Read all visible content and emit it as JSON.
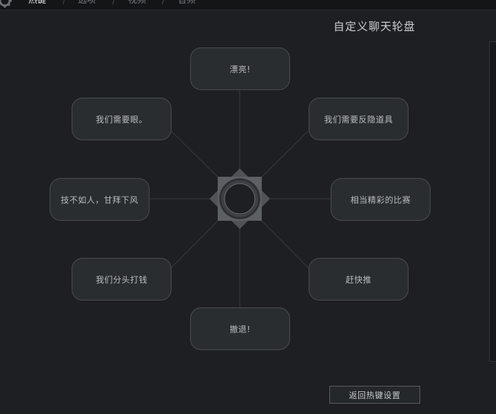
{
  "nav": {
    "tabs": [
      {
        "label": "热键",
        "active": true
      },
      {
        "label": "选项",
        "active": false
      },
      {
        "label": "视频",
        "active": false
      },
      {
        "label": "音频",
        "active": false
      }
    ],
    "separator": "/"
  },
  "page": {
    "title": "自定义聊天轮盘"
  },
  "wheel": {
    "slots": [
      {
        "id": "top",
        "label": "漂亮!"
      },
      {
        "id": "top-right",
        "label": "我们需要反隐道具"
      },
      {
        "id": "right",
        "label": "相当精彩的比赛"
      },
      {
        "id": "bottom-right",
        "label": "赶快推"
      },
      {
        "id": "bottom",
        "label": "撤退!"
      },
      {
        "id": "bottom-left",
        "label": "我们分头打钱"
      },
      {
        "id": "left",
        "label": "技不如人，甘拜下风"
      },
      {
        "id": "top-left",
        "label": "我们需要眼。"
      }
    ]
  },
  "footer": {
    "back_label": "返回热键设置"
  },
  "colors": {
    "background": "#1d1f22",
    "slot_bg": "#2a2d30",
    "slot_border": "#4a4e53",
    "hub": "#5c5f63",
    "active_tab": "#f2f2f2"
  }
}
